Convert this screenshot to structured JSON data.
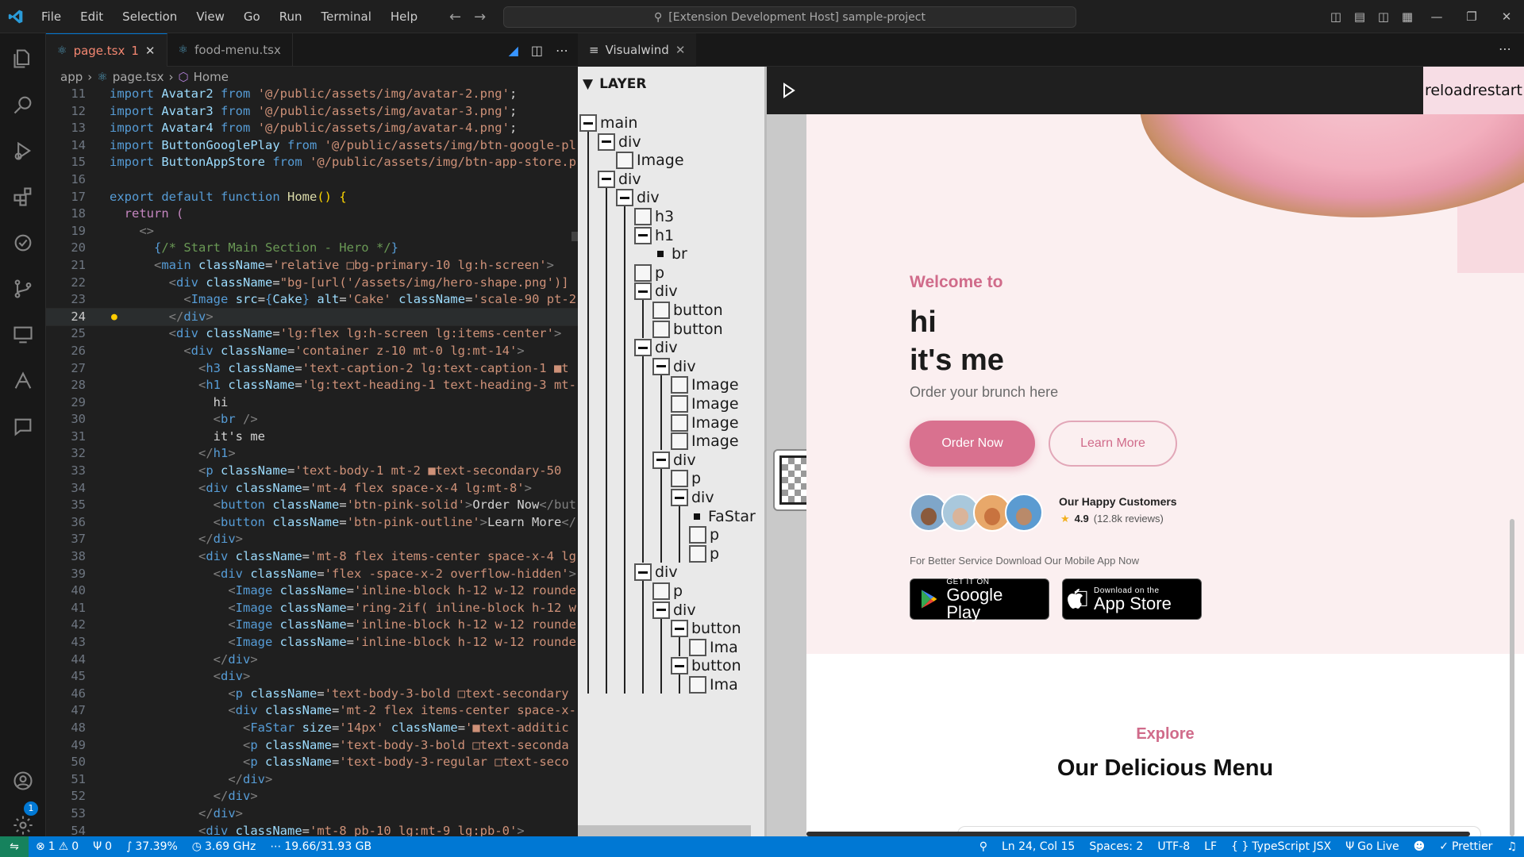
{
  "titlebar": {
    "menu": [
      "File",
      "Edit",
      "Selection",
      "View",
      "Go",
      "Run",
      "Terminal",
      "Help"
    ],
    "command_center": "[Extension Development Host] sample-project"
  },
  "editor": {
    "tabs": [
      {
        "label": "page.tsx",
        "badge": "1"
      },
      {
        "label": "food-menu.tsx"
      }
    ],
    "breadcrumb": [
      "app",
      "page.tsx",
      "Home"
    ],
    "lines": [
      {
        "n": "11",
        "html": "<span class='kw'>import</span> <span class='a'>Avatar2</span> <span class='kw'>from</span> <span class='s'>'@/public/assets/img/avatar-2.png'</span><span class='tx'>;</span>"
      },
      {
        "n": "12",
        "html": "<span class='kw'>import</span> <span class='a'>Avatar3</span> <span class='kw'>from</span> <span class='s'>'@/public/assets/img/avatar-3.png'</span><span class='tx'>;</span>"
      },
      {
        "n": "13",
        "html": "<span class='kw'>import</span> <span class='a'>Avatar4</span> <span class='kw'>from</span> <span class='s'>'@/public/assets/img/avatar-4.png'</span><span class='tx'>;</span>"
      },
      {
        "n": "14",
        "html": "<span class='kw'>import</span> <span class='a'>ButtonGooglePlay</span> <span class='kw'>from</span> <span class='s'>'@/public/assets/img/btn-google-pl</span>"
      },
      {
        "n": "15",
        "html": "<span class='kw'>import</span> <span class='a'>ButtonAppStore</span> <span class='kw'>from</span> <span class='s'>'@/public/assets/img/btn-app-store.p</span>"
      },
      {
        "n": "16",
        "html": ""
      },
      {
        "n": "17",
        "html": "<span class='kw'>export</span> <span class='kw'>default</span> <span class='kw'>function</span> <span class='f'>Home</span><span class='y'>()</span> <span class='y'>{</span>"
      },
      {
        "n": "18",
        "html": "  <span class='k'>return</span> <span class='k'>(</span>"
      },
      {
        "n": "19",
        "html": "    <span class='p'>&lt;&gt;</span>"
      },
      {
        "n": "20",
        "html": "      <span class='kw'>{</span><span class='c'>/* Start Main Section - Hero */</span><span class='kw'>}</span>"
      },
      {
        "n": "21",
        "html": "      <span class='p'>&lt;</span><span class='t'>main</span> <span class='a'>className</span><span class='tx'>=</span><span class='s'>'relative &#9633;bg-primary-10 lg:h-screen'</span><span class='p'>&gt;</span>"
      },
      {
        "n": "22",
        "html": "        <span class='p'>&lt;</span><span class='t'>div</span> <span class='a'>className</span><span class='tx'>=</span><span class='s'>\"bg-[url('/assets/img/hero-shape.png')]</span>"
      },
      {
        "n": "23",
        "html": "          <span class='p'>&lt;</span><span class='t'>Image</span> <span class='a'>src</span><span class='tx'>=</span><span class='kw'>{</span><span class='a'>Cake</span><span class='kw'>}</span> <span class='a'>alt</span><span class='tx'>=</span><span class='s'>'Cake'</span> <span class='a'>className</span><span class='tx'>=</span><span class='s'>'scale-90 pt-2</span>"
      },
      {
        "n": "24",
        "html": "        <span class='p'>&lt;/</span><span class='t'>div</span><span class='p'>&gt;</span>",
        "cur": true
      },
      {
        "n": "25",
        "html": "        <span class='p'>&lt;</span><span class='t'>div</span> <span class='a'>className</span><span class='tx'>=</span><span class='s'>'lg:flex lg:h-screen lg:items-center'</span><span class='p'>&gt;</span>"
      },
      {
        "n": "26",
        "html": "          <span class='p'>&lt;</span><span class='t'>div</span> <span class='a'>className</span><span class='tx'>=</span><span class='s'>'container z-10 mt-0 lg:mt-14'</span><span class='p'>&gt;</span>"
      },
      {
        "n": "27",
        "html": "            <span class='p'>&lt;</span><span class='t'>h3</span> <span class='a'>className</span><span class='tx'>=</span><span class='s'>'text-caption-2 lg:text-caption-1 &#9632;t</span>"
      },
      {
        "n": "28",
        "html": "            <span class='p'>&lt;</span><span class='t'>h1</span> <span class='a'>className</span><span class='tx'>=</span><span class='s'>'lg:text-heading-1 text-heading-3 mt-</span>"
      },
      {
        "n": "29",
        "html": "              <span class='tx'>hi</span>"
      },
      {
        "n": "30",
        "html": "              <span class='p'>&lt;</span><span class='t'>br</span> <span class='p'>/&gt;</span>"
      },
      {
        "n": "31",
        "html": "              <span class='tx'>it's me</span>"
      },
      {
        "n": "32",
        "html": "            <span class='p'>&lt;/</span><span class='t'>h1</span><span class='p'>&gt;</span>"
      },
      {
        "n": "33",
        "html": "            <span class='p'>&lt;</span><span class='t'>p</span> <span class='a'>className</span><span class='tx'>=</span><span class='s'>'text-body-1 mt-2 &#9632;text-secondary-50</span>"
      },
      {
        "n": "34",
        "html": "            <span class='p'>&lt;</span><span class='t'>div</span> <span class='a'>className</span><span class='tx'>=</span><span class='s'>'mt-4 flex space-x-4 lg:mt-8'</span><span class='p'>&gt;</span>"
      },
      {
        "n": "35",
        "html": "              <span class='p'>&lt;</span><span class='t'>button</span> <span class='a'>className</span><span class='tx'>=</span><span class='s'>'btn-pink-solid'</span><span class='p'>&gt;</span><span class='tx'>Order Now</span><span class='p'>&lt;/but</span>"
      },
      {
        "n": "36",
        "html": "              <span class='p'>&lt;</span><span class='t'>button</span> <span class='a'>className</span><span class='tx'>=</span><span class='s'>'btn-pink-outline'</span><span class='p'>&gt;</span><span class='tx'>Learn More</span><span class='p'>&lt;/</span>"
      },
      {
        "n": "37",
        "html": "            <span class='p'>&lt;/</span><span class='t'>div</span><span class='p'>&gt;</span>"
      },
      {
        "n": "38",
        "html": "            <span class='p'>&lt;</span><span class='t'>div</span> <span class='a'>className</span><span class='tx'>=</span><span class='s'>'mt-8 flex items-center space-x-4 lg</span>"
      },
      {
        "n": "39",
        "html": "              <span class='p'>&lt;</span><span class='t'>div</span> <span class='a'>className</span><span class='tx'>=</span><span class='s'>'flex -space-x-2 overflow-hidden'</span><span class='p'>&gt;</span>"
      },
      {
        "n": "40",
        "html": "                <span class='p'>&lt;</span><span class='t'>Image</span> <span class='a'>className</span><span class='tx'>=</span><span class='s'>'inline-block h-12 w-12 rounde</span>"
      },
      {
        "n": "41",
        "html": "                <span class='p'>&lt;</span><span class='t'>Image</span> <span class='a'>className</span><span class='tx'>=</span><span class='s'>'ring-2if( inline-block h-12 w</span>"
      },
      {
        "n": "42",
        "html": "                <span class='p'>&lt;</span><span class='t'>Image</span> <span class='a'>className</span><span class='tx'>=</span><span class='s'>'inline-block h-12 w-12 rounde</span>"
      },
      {
        "n": "43",
        "html": "                <span class='p'>&lt;</span><span class='t'>Image</span> <span class='a'>className</span><span class='tx'>=</span><span class='s'>'inline-block h-12 w-12 rounde</span>"
      },
      {
        "n": "44",
        "html": "              <span class='p'>&lt;/</span><span class='t'>div</span><span class='p'>&gt;</span>"
      },
      {
        "n": "45",
        "html": "              <span class='p'>&lt;</span><span class='t'>div</span><span class='p'>&gt;</span>"
      },
      {
        "n": "46",
        "html": "                <span class='p'>&lt;</span><span class='t'>p</span> <span class='a'>className</span><span class='tx'>=</span><span class='s'>'text-body-3-bold &#9633;text-secondary</span>"
      },
      {
        "n": "47",
        "html": "                <span class='p'>&lt;</span><span class='t'>div</span> <span class='a'>className</span><span class='tx'>=</span><span class='s'>'mt-2 flex items-center space-x-</span>"
      },
      {
        "n": "48",
        "html": "                  <span class='p'>&lt;</span><span class='t'>FaStar</span> <span class='a'>size</span><span class='tx'>=</span><span class='s'>'14px'</span> <span class='a'>className</span><span class='tx'>=</span><span class='s'>'&#9632;text-additic</span>"
      },
      {
        "n": "49",
        "html": "                  <span class='p'>&lt;</span><span class='t'>p</span> <span class='a'>className</span><span class='tx'>=</span><span class='s'>'text-body-3-bold &#9633;text-seconda</span>"
      },
      {
        "n": "50",
        "html": "                  <span class='p'>&lt;</span><span class='t'>p</span> <span class='a'>className</span><span class='tx'>=</span><span class='s'>'text-body-3-regular &#9633;text-seco</span>"
      },
      {
        "n": "51",
        "html": "                <span class='p'>&lt;/</span><span class='t'>div</span><span class='p'>&gt;</span>"
      },
      {
        "n": "52",
        "html": "              <span class='p'>&lt;/</span><span class='t'>div</span><span class='p'>&gt;</span>"
      },
      {
        "n": "53",
        "html": "            <span class='p'>&lt;/</span><span class='t'>div</span><span class='p'>&gt;</span>"
      },
      {
        "n": "54",
        "html": "            <span class='p'>&lt;</span><span class='t'>div</span> <span class='a'>className</span><span class='tx'>=</span><span class='s'>'mt-8 pb-10 lg:mt-9 lg:pb-0'</span><span class='p'>&gt;</span>"
      }
    ]
  },
  "visualwind": {
    "tab_label": "Visualwind",
    "layer_header": "LAYER",
    "reload_label": "reload",
    "restart_label": "restart",
    "tree": [
      {
        "label": "main",
        "depth": 0,
        "kind": "minus"
      },
      {
        "label": "div",
        "depth": 1,
        "kind": "minus"
      },
      {
        "label": "Image",
        "depth": 2,
        "kind": "box"
      },
      {
        "label": "div",
        "depth": 1,
        "kind": "minus"
      },
      {
        "label": "div",
        "depth": 2,
        "kind": "minus"
      },
      {
        "label": "h3",
        "depth": 3,
        "kind": "box"
      },
      {
        "label": "h1",
        "depth": 3,
        "kind": "minus"
      },
      {
        "label": "br",
        "depth": 4,
        "kind": "dot"
      },
      {
        "label": "p",
        "depth": 3,
        "kind": "box"
      },
      {
        "label": "div",
        "depth": 3,
        "kind": "minus"
      },
      {
        "label": "button",
        "depth": 4,
        "kind": "box"
      },
      {
        "label": "button",
        "depth": 4,
        "kind": "box"
      },
      {
        "label": "div",
        "depth": 3,
        "kind": "minus"
      },
      {
        "label": "div",
        "depth": 4,
        "kind": "minus"
      },
      {
        "label": "Image",
        "depth": 5,
        "kind": "box"
      },
      {
        "label": "Image",
        "depth": 5,
        "kind": "box"
      },
      {
        "label": "Image",
        "depth": 5,
        "kind": "box"
      },
      {
        "label": "Image",
        "depth": 5,
        "kind": "box"
      },
      {
        "label": "div",
        "depth": 4,
        "kind": "minus"
      },
      {
        "label": "p",
        "depth": 5,
        "kind": "box"
      },
      {
        "label": "div",
        "depth": 5,
        "kind": "minus"
      },
      {
        "label": "FaStar",
        "depth": 6,
        "kind": "dot"
      },
      {
        "label": "p",
        "depth": 6,
        "kind": "box"
      },
      {
        "label": "p",
        "depth": 6,
        "kind": "box"
      },
      {
        "label": "div",
        "depth": 3,
        "kind": "minus"
      },
      {
        "label": "p",
        "depth": 4,
        "kind": "box"
      },
      {
        "label": "div",
        "depth": 4,
        "kind": "minus"
      },
      {
        "label": "button",
        "depth": 5,
        "kind": "minus"
      },
      {
        "label": "Ima",
        "depth": 6,
        "kind": "box"
      },
      {
        "label": "button",
        "depth": 5,
        "kind": "minus"
      },
      {
        "label": "Ima",
        "depth": 6,
        "kind": "box"
      }
    ],
    "site": {
      "welcome": "Welcome to",
      "headline_1": "hi",
      "headline_2": "it's me",
      "subtitle": "Order your brunch here",
      "order_btn": "Order Now",
      "learn_btn": "Learn More",
      "happy_customers": "Our Happy Customers",
      "rating_value": "4.9",
      "rating_reviews": "(12.8k reviews)",
      "better_service": "For Better Service Download Our Mobile App Now",
      "google_small": "GET IT ON",
      "google_big": "Google Play",
      "apple_small": "Download on the",
      "apple_big": "App Store",
      "explore": "Explore",
      "menu_heading": "Our Delicious Menu"
    }
  },
  "statusbar": {
    "errors": "1",
    "warnings": "0",
    "ports": "0",
    "cpu": "37.39%",
    "freq": "3.69 GHz",
    "mem": "19.66/31.93 GB",
    "position": "Ln 24, Col 15",
    "spaces": "Spaces: 2",
    "encoding": "UTF-8",
    "eol": "LF",
    "language": "TypeScript JSX",
    "golive": "Go Live",
    "prettier": "Prettier"
  },
  "colors": {
    "accent": "#0078d4",
    "pink": "#d9718f",
    "hero_bg": "#fbeff0"
  }
}
